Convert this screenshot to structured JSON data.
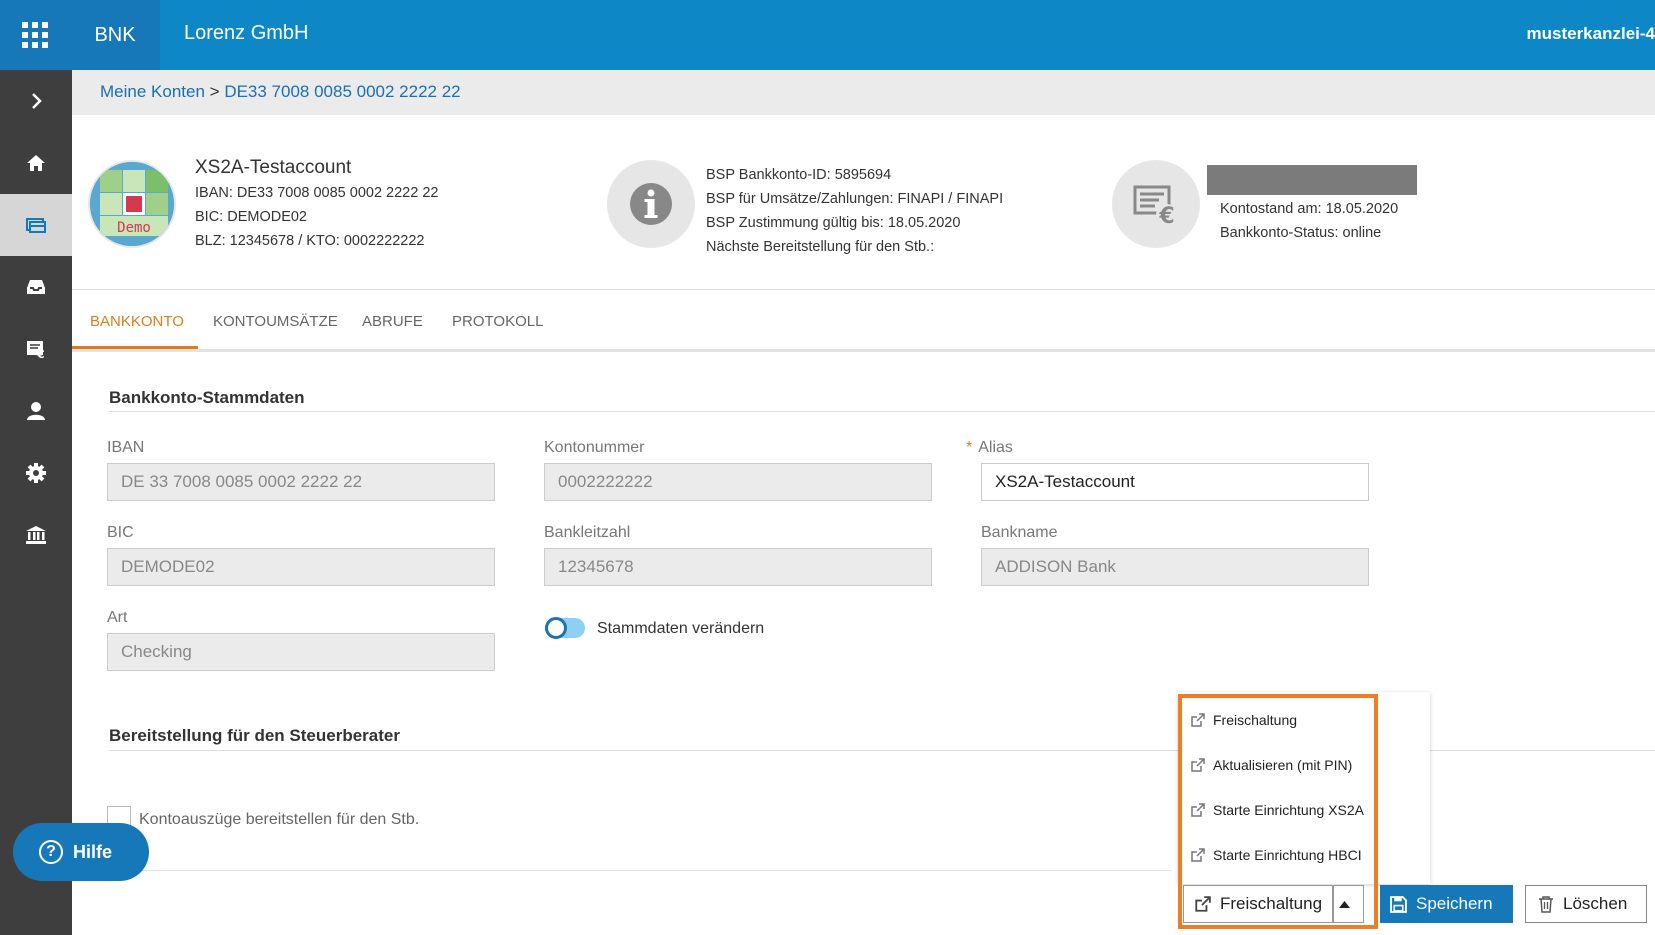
{
  "topbar": {
    "app": "BNK",
    "company": "Lorenz GmbH",
    "tenant": "musterkanzlei-4"
  },
  "breadcrumb": {
    "root": "Meine Konten",
    "separator": ">",
    "current": "DE33 7008 0085 0002 2222 22"
  },
  "account": {
    "title": "XS2A-Testaccount",
    "iban": "IBAN: DE33 7008 0085 0002 2222 22",
    "bic": "BIC: DEMODE02",
    "blz": "BLZ: 12345678 / KTO: 0002222222",
    "avatar_label": "Demo"
  },
  "bsp": {
    "id": "BSP Bankkonto-ID: 5895694",
    "provider": "BSP für Umsätze/Zahlungen: FINAPI / FINAPI",
    "consent": "BSP Zustimmung gültig bis: 18.05.2020",
    "next": "Nächste Bereitstellung für den Stb.:"
  },
  "balance": {
    "date": "Kontostand am: 18.05.2020",
    "status": "Bankkonto-Status: online"
  },
  "tabs": [
    "BANKKONTO",
    "KONTOUMSÄTZE",
    "ABRUFE",
    "PROTOKOLL"
  ],
  "stammdaten": {
    "title": "Bankkonto-Stammdaten",
    "iban_label": "IBAN",
    "iban_value": "DE 33 7008 0085 0002 2222 22",
    "kontonummer_label": "Kontonummer",
    "kontonummer_value": "0002222222",
    "alias_required": "*",
    "alias_label": "Alias",
    "alias_value": "XS2A-Testaccount",
    "bic_label": "BIC",
    "bic_value": "DEMODE02",
    "blz_label": "Bankleitzahl",
    "blz_value": "12345678",
    "bankname_label": "Bankname",
    "bankname_value": "ADDISON Bank",
    "art_label": "Art",
    "art_value": "Checking",
    "toggle_label": "Stammdaten verändern"
  },
  "bereitstellung": {
    "title": "Bereitstellung für den Steuerberater",
    "checkbox_label": "Kontoauszüge bereitstellen für den Stb."
  },
  "help": {
    "label": "Hilfe",
    "glyph": "?"
  },
  "dropdown": {
    "items": [
      "Freischaltung",
      "Aktualisieren (mit PIN)",
      "Starte Einrichtung XS2A",
      "Starte Einrichtung HBCI"
    ]
  },
  "actions": {
    "split_label": "Freischaltung",
    "save_label": "Speichern",
    "delete_label": "Löschen"
  },
  "colors": {
    "brand_blue": "#0e87c7",
    "accent_orange": "#e07b1a",
    "sidebar": "#3e3e3e"
  }
}
